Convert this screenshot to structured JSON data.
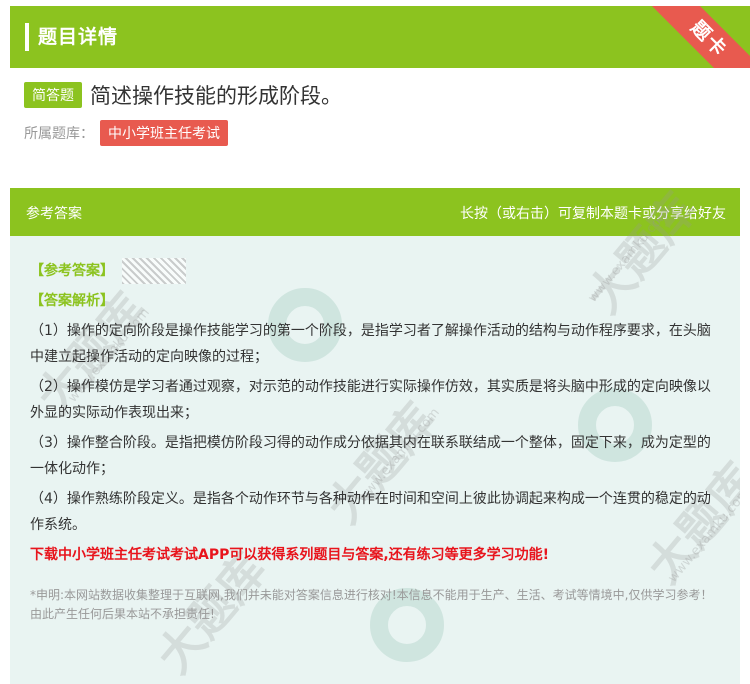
{
  "header": {
    "title": "题目详情",
    "ribbon": "题卡"
  },
  "question": {
    "tag": "简答题",
    "title": "简述操作技能的形成阶段。",
    "bank_label": "所属题库：",
    "bank_name": "中小学班主任考试"
  },
  "answer": {
    "head_left": "参考答案",
    "head_right": "长按（或右击）可复制本题卡或分享给好友",
    "answer_label": "【参考答案】",
    "analysis_label": "【答案解析】",
    "paragraphs": [
      "（1）操作的定向阶段是操作技能学习的第一个阶段，是指学习者了解操作活动的结构与动作程序要求，在头脑中建立起操作活动的定向映像的过程；",
      "（2）操作模仿是学习者通过观察，对示范的动作技能进行实际操作仿效，其实质是将头脑中形成的定向映像以外显的实际动作表现出来；",
      "（3）操作整合阶段。是指把模仿阶段习得的动作成分依据其内在联系联结成一个整体，固定下来，成为定型的一体化动作；",
      "（4）操作熟练阶段定义。是指各个动作环节与各种动作在时间和空间上彼此协调起来构成一个连贯的稳定的动作系统。"
    ],
    "promo": "下载中小学班主任考试考试APP可以获得系列题目与答案,还有练习等更多学习功能!",
    "disclaimer": "*申明:本网站数据收集整理于互联网,我们并未能对答案信息进行核对!本信息不能用于生产、生活、考试等情境中,仅供学习参考！由此产生任何后果本站不承担责任!"
  },
  "watermark": {
    "text": "大题库",
    "url": "www.examku.com"
  }
}
